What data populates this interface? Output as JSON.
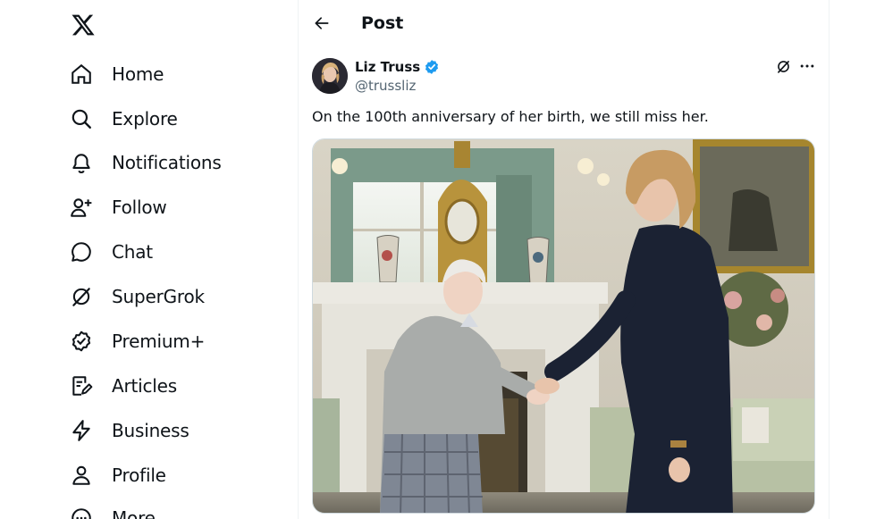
{
  "nav": {
    "items": [
      {
        "label": "Home",
        "icon": "home-icon"
      },
      {
        "label": "Explore",
        "icon": "search-icon"
      },
      {
        "label": "Notifications",
        "icon": "bell-icon"
      },
      {
        "label": "Follow",
        "icon": "follow-icon"
      },
      {
        "label": "Chat",
        "icon": "chat-icon"
      },
      {
        "label": "SuperGrok",
        "icon": "grok-icon"
      },
      {
        "label": "Premium+",
        "icon": "verified-badge-icon"
      },
      {
        "label": "Articles",
        "icon": "articles-icon"
      },
      {
        "label": "Business",
        "icon": "lightning-icon"
      },
      {
        "label": "Profile",
        "icon": "person-icon"
      },
      {
        "label": "More",
        "icon": "more-circle-icon"
      }
    ]
  },
  "header": {
    "title": "Post"
  },
  "post": {
    "author_name": "Liz Truss",
    "author_handle": "@trussliz",
    "text": "On the 100th anniversary of her birth, we still miss her."
  },
  "colors": {
    "accent": "#1d9bf0",
    "text": "#0f1419",
    "muted": "#536471"
  }
}
